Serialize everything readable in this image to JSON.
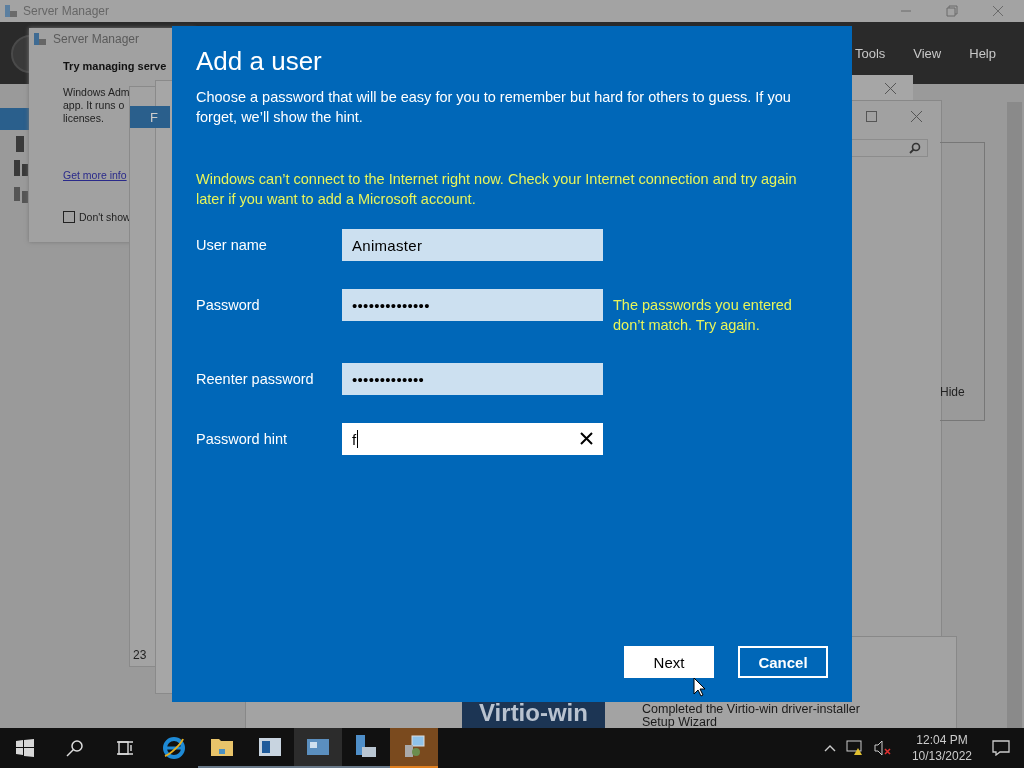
{
  "background": {
    "title": "Server Manager",
    "menu": [
      "Tools",
      "View",
      "Help"
    ],
    "popup": {
      "title": "Server Manager",
      "heading": "Try managing serve",
      "lines": [
        "Windows Adm",
        "app. It runs o",
        "licenses."
      ],
      "link": "Get more info",
      "checkbox": {
        "label": "Don't show",
        "checked": false
      }
    },
    "tab_letter": "F",
    "hide_label": "Hide",
    "number": "23",
    "installer": {
      "banner": "Virtio-win",
      "lines": [
        "Completed the Virtio-win driver-installer",
        "Setup Wizard"
      ]
    }
  },
  "dialog": {
    "title": "Add a user",
    "description": "Choose a password that will be easy for you to remember but hard for others to guess. If you forget, we’ll show the hint.",
    "warning": "Windows can’t connect to the Internet right now. Check your Internet connection and try again later if you want to add a Microsoft account.",
    "fields": [
      {
        "label": "User name",
        "value": "Animaster",
        "focused": false
      },
      {
        "label": "Password",
        "value": "••••••••••••••",
        "focused": false,
        "error": "The passwords you entered don’t match. Try again."
      },
      {
        "label": "Reenter password",
        "value": "•••••••••••••",
        "focused": false
      },
      {
        "label": "Password hint",
        "value": "f",
        "focused": true
      }
    ],
    "buttons": [
      {
        "label": "Next",
        "kind": "primary"
      },
      {
        "label": "Cancel",
        "kind": "secondary"
      }
    ]
  },
  "taskbar": {
    "apps": [
      {
        "kind": "ie",
        "open": false,
        "selected": false
      },
      {
        "kind": "folder",
        "open": true,
        "selected": false
      },
      {
        "kind": "panel",
        "open": true,
        "selected": false
      },
      {
        "kind": "monitor",
        "open": true,
        "selected": true
      },
      {
        "kind": "server",
        "open": true,
        "selected": false
      },
      {
        "kind": "installer",
        "open": true,
        "selected": true
      }
    ],
    "time": "12:04 PM",
    "date": "10/13/2022"
  }
}
